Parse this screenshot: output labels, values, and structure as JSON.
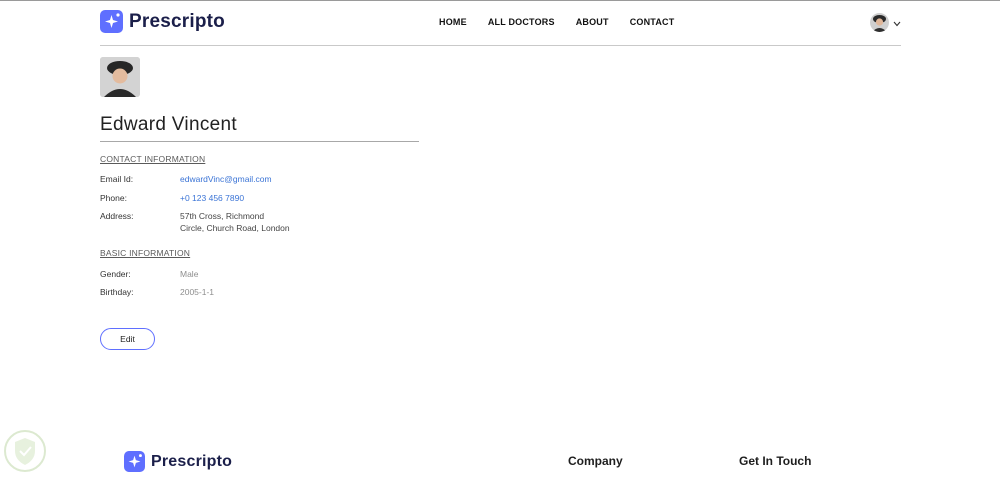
{
  "brand": {
    "name": "Prescripto"
  },
  "nav": {
    "items": [
      "HOME",
      "ALL DOCTORS",
      "ABOUT",
      "CONTACT"
    ]
  },
  "profile": {
    "name": "Edward Vincent",
    "contact_title": "CONTACT INFORMATION",
    "email_label": "Email Id:",
    "email": "edwardVinc@gmail.com",
    "phone_label": "Phone:",
    "phone": "+0 123 456 7890",
    "address_label": "Address:",
    "address_line1": "57th Cross, Richmond",
    "address_line2": "Circle, Church Road, London",
    "basic_title": "BASIC INFORMATION",
    "gender_label": "Gender:",
    "gender": "Male",
    "birthday_label": "Birthday:",
    "birthday": "2005-1-1",
    "edit_label": "Edit"
  },
  "footer": {
    "company_heading": "Company",
    "contact_heading": "Get In Touch"
  },
  "colors": {
    "accent": "#5f6fff",
    "link_blue": "#3b74d6"
  }
}
